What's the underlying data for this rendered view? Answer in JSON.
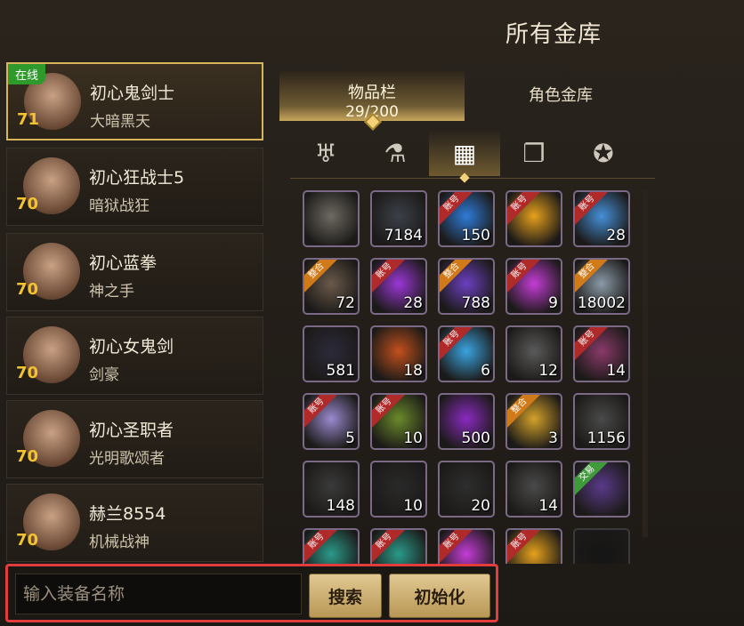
{
  "window": {
    "title": "所有金库"
  },
  "characters": [
    {
      "name": "初心鬼剑士",
      "title": "大暗黑天",
      "level": "71",
      "online": "在线",
      "selected": true
    },
    {
      "name": "初心狂战士5",
      "title": "暗狱战狂",
      "level": "70"
    },
    {
      "name": "初心蓝拳",
      "title": "神之手",
      "level": "70"
    },
    {
      "name": "初心女鬼剑",
      "title": "剑豪",
      "level": "70"
    },
    {
      "name": "初心圣职者",
      "title": "光明歌颂者",
      "level": "70"
    },
    {
      "name": "赫兰8554",
      "title": "机械战神",
      "level": "70"
    }
  ],
  "tabs": [
    {
      "label": "物品栏",
      "sub": "29/200",
      "active": true
    },
    {
      "label": "角色金库",
      "sub": ""
    }
  ],
  "categories": [
    {
      "icon": "armor-icon"
    },
    {
      "icon": "potion-icon"
    },
    {
      "icon": "material-icon",
      "active": true
    },
    {
      "icon": "cards-icon"
    },
    {
      "icon": "pentagram-icon"
    }
  ],
  "items": [
    {
      "count": "",
      "color": "#6d6a62",
      "tag": ""
    },
    {
      "count": "7184",
      "color": "#3b4048",
      "tag": ""
    },
    {
      "count": "150",
      "color": "#2e7bd8",
      "tag": "账号"
    },
    {
      "count": "",
      "color": "#e6a11c",
      "tag": "账号"
    },
    {
      "count": "28",
      "color": "#4590d8",
      "tag": "账号"
    },
    {
      "count": "72",
      "color": "#6a5a4a",
      "tag": "整合"
    },
    {
      "count": "28",
      "color": "#9a37d6",
      "tag": "账号"
    },
    {
      "count": "788",
      "color": "#6b3fc0",
      "tag": "整合"
    },
    {
      "count": "9",
      "color": "#c43cd6",
      "tag": "账号"
    },
    {
      "count": "18002",
      "color": "#8a9aa8",
      "tag": "整合"
    },
    {
      "count": "581",
      "color": "#2c2a3a",
      "tag": ""
    },
    {
      "count": "18",
      "color": "#c2501c",
      "tag": ""
    },
    {
      "count": "6",
      "color": "#3aa4e0",
      "tag": "账号"
    },
    {
      "count": "12",
      "color": "#5a5a5a",
      "tag": ""
    },
    {
      "count": "14",
      "color": "#8a3a6a",
      "tag": "账号"
    },
    {
      "count": "5",
      "color": "#9a8ad0",
      "tag": "账号"
    },
    {
      "count": "10",
      "color": "#6a8a2a",
      "tag": "账号"
    },
    {
      "count": "500",
      "color": "#8a2ac0",
      "tag": ""
    },
    {
      "count": "3",
      "color": "#d4a22a",
      "tag": "整合"
    },
    {
      "count": "1156",
      "color": "#4a4a4a",
      "tag": ""
    },
    {
      "count": "148",
      "color": "#3a3a3a",
      "tag": ""
    },
    {
      "count": "10",
      "color": "#2a2a2a",
      "tag": ""
    },
    {
      "count": "20",
      "color": "#2e2e2e",
      "tag": ""
    },
    {
      "count": "14",
      "color": "#4a4a4a",
      "tag": ""
    },
    {
      "count": "",
      "color": "#5a3a8a",
      "tag": "交易"
    },
    {
      "count": "",
      "color": "#2a9a8a",
      "tag": "账号"
    },
    {
      "count": "",
      "color": "#2a9a8a",
      "tag": "账号"
    },
    {
      "count": "",
      "color": "#c43cd6",
      "tag": "账号"
    },
    {
      "count": "",
      "color": "#e6a11c",
      "tag": "账号"
    },
    {
      "count": "",
      "color": "#151515",
      "tag": ""
    }
  ],
  "footer": {
    "search_placeholder": "输入装备名称",
    "search_button": "搜索",
    "reset_button": "初始化"
  }
}
